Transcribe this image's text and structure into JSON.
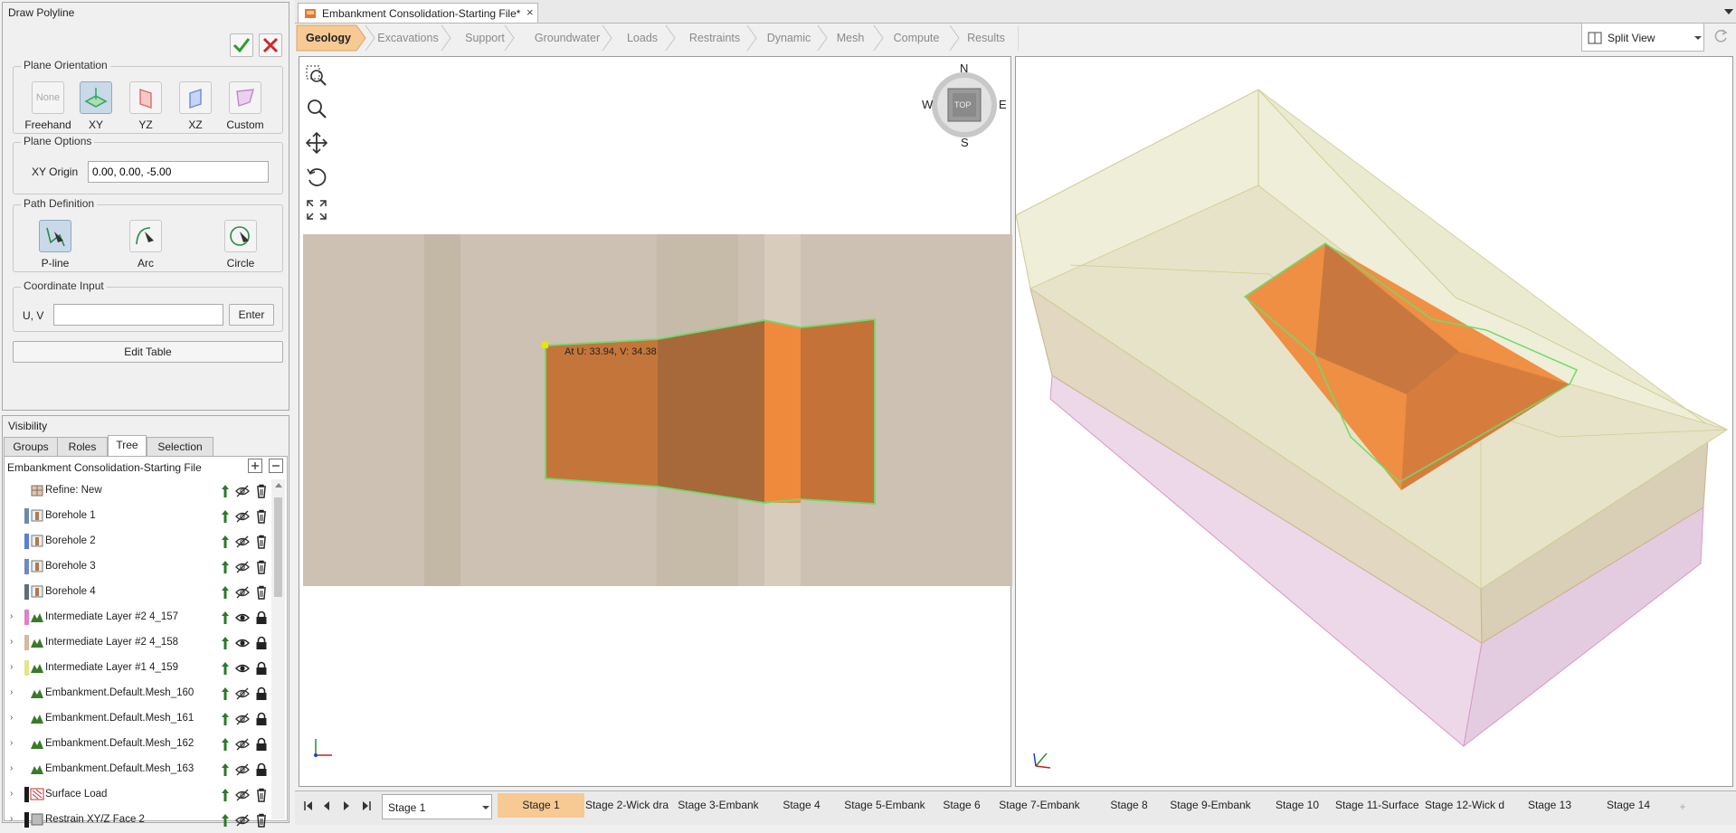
{
  "draw_polyline": {
    "title": "Draw Polyline",
    "plane_orientation": {
      "label": "Plane Orientation",
      "options": [
        {
          "label": "Freehand",
          "button": "None"
        },
        {
          "label": "XY"
        },
        {
          "label": "YZ"
        },
        {
          "label": "XZ"
        },
        {
          "label": "Custom"
        }
      ]
    },
    "plane_options": {
      "label": "Plane Options",
      "origin_label": "XY Origin",
      "origin_value": "0.00, 0.00, -5.00"
    },
    "path_definition": {
      "label": "Path Definition",
      "options": [
        {
          "label": "P-line"
        },
        {
          "label": "Arc"
        },
        {
          "label": "Circle"
        }
      ]
    },
    "coordinate_input": {
      "label": "Coordinate Input",
      "uv_label": "U, V",
      "uv_value": "",
      "enter_label": "Enter"
    },
    "edit_table_label": "Edit Table"
  },
  "visibility": {
    "title": "Visibility",
    "tabs": [
      "Groups",
      "Roles",
      "Tree",
      "Selection"
    ],
    "active_tab": "Tree",
    "root": "Embankment Consolidation-Starting File",
    "items": [
      {
        "name": "Refine: New",
        "swatch": "",
        "expand": false,
        "kind": "refine",
        "eye": "hidden",
        "last": "trash"
      },
      {
        "name": "Borehole 1",
        "swatch": "#6b8aa8",
        "expand": false,
        "kind": "borehole",
        "eye": "hidden",
        "last": "trash"
      },
      {
        "name": "Borehole 2",
        "swatch": "#5b7fd6",
        "expand": false,
        "kind": "borehole",
        "eye": "hidden",
        "last": "trash"
      },
      {
        "name": "Borehole 3",
        "swatch": "#6a8cc8",
        "expand": false,
        "kind": "borehole",
        "eye": "hidden",
        "last": "trash"
      },
      {
        "name": "Borehole 4",
        "swatch": "#5d6e7c",
        "expand": false,
        "kind": "borehole",
        "eye": "hidden",
        "last": "trash"
      },
      {
        "name": "Intermediate Layer #2 4_157",
        "swatch": "#e080c8",
        "expand": true,
        "kind": "layer",
        "eye": "visible",
        "last": "lock"
      },
      {
        "name": "Intermediate Layer #2 4_158",
        "swatch": "#d6b8a0",
        "expand": true,
        "kind": "layer",
        "eye": "visible",
        "last": "lock"
      },
      {
        "name": "Intermediate Layer #1 4_159",
        "swatch": "#e4e48a",
        "expand": true,
        "kind": "layer",
        "eye": "visible",
        "last": "lock"
      },
      {
        "name": "Embankment.Default.Mesh_160",
        "swatch": "",
        "expand": true,
        "kind": "layer",
        "eye": "hidden",
        "last": "lock"
      },
      {
        "name": "Embankment.Default.Mesh_161",
        "swatch": "",
        "expand": true,
        "kind": "layer",
        "eye": "hidden",
        "last": "lock"
      },
      {
        "name": "Embankment.Default.Mesh_162",
        "swatch": "",
        "expand": true,
        "kind": "layer",
        "eye": "hidden",
        "last": "lock"
      },
      {
        "name": "Embankment.Default.Mesh_163",
        "swatch": "",
        "expand": true,
        "kind": "layer",
        "eye": "hidden",
        "last": "lock"
      },
      {
        "name": "Surface Load",
        "swatch": "#1a1a1a",
        "expand": true,
        "kind": "load",
        "eye": "hidden",
        "last": "trash"
      },
      {
        "name": "Restrain XY/Z Face 2",
        "swatch": "#1a1a1a",
        "expand": true,
        "kind": "restrain",
        "eye": "hidden",
        "last": "trash"
      }
    ]
  },
  "document_tab": "Embankment Consolidation-Starting File*",
  "workflow_tabs": [
    "Geology",
    "Excavations",
    "Support",
    "Groundwater",
    "Loads",
    "Restraints",
    "Dynamic",
    "Mesh",
    "Compute",
    "Results"
  ],
  "active_workflow": "Geology",
  "view_mode": "Split View",
  "compass": {
    "n": "N",
    "s": "S",
    "e": "E",
    "w": "W",
    "center": "TOP"
  },
  "cursor_tooltip": "At U: 33.94, V: 34.38",
  "stage_selector": "Stage 1",
  "stages": [
    "Stage 1",
    "Stage 2-Wick dra",
    "Stage 3-Embank",
    "Stage 4",
    "Stage 5-Embank",
    "Stage 6",
    "Stage 7-Embank",
    "Stage 8",
    "Stage 9-Embank",
    "Stage 10",
    "Stage 11-Surface",
    "Stage 12-Wick d",
    "Stage 13",
    "Stage 14"
  ],
  "active_stage": "Stage 1",
  "add_stage_label": "+",
  "colors": {
    "accent_orange": "#ef8a3c",
    "active_tab": "#f7c993",
    "selection_green": "#6cdc6c"
  }
}
